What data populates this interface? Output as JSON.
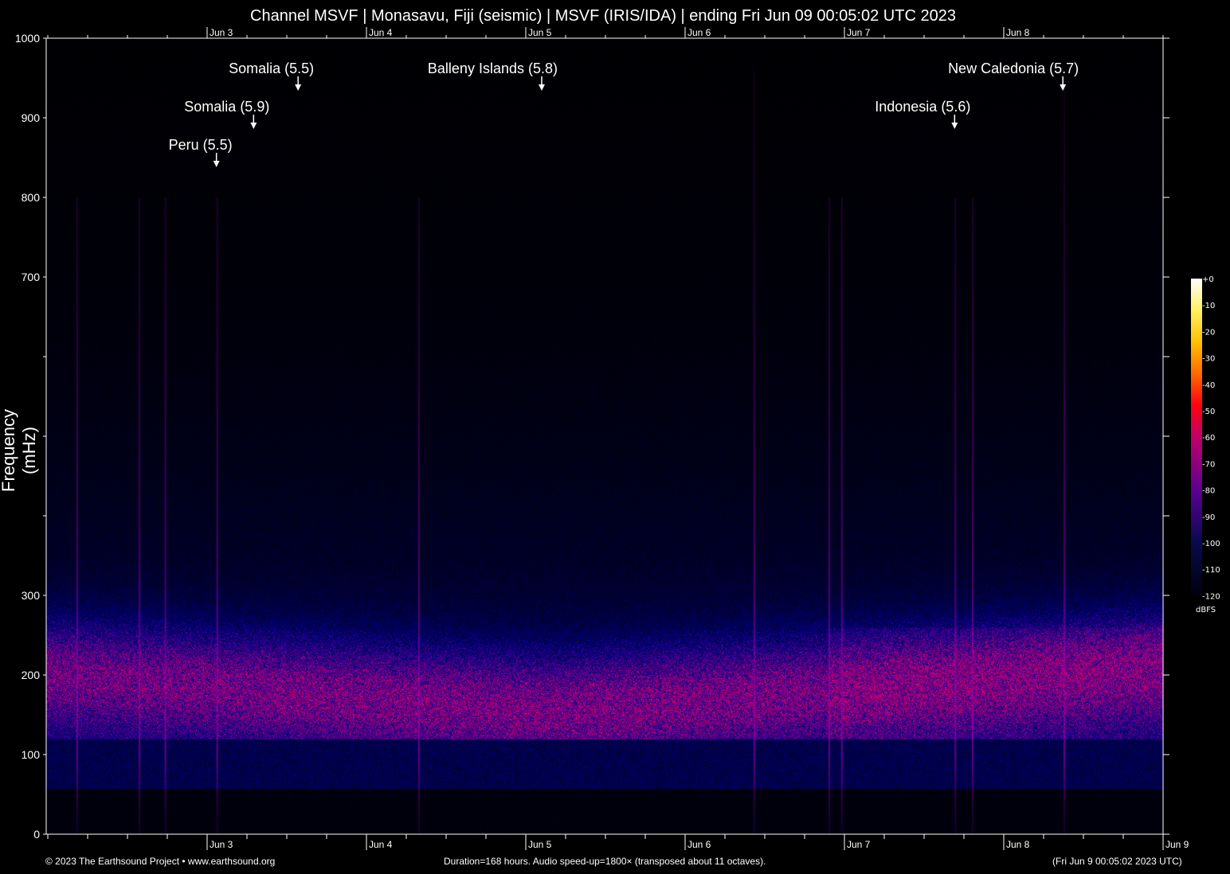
{
  "chart_data": {
    "type": "heatmap",
    "title": "Channel MSVF | Monasavu, Fiji (seismic) | MSVF (IRIS/IDA) | ending Fri Jun 09 00:05:02 UTC 2023",
    "ylabel": "Frequency (mHz)",
    "ylim": [
      0,
      1000
    ],
    "yticks": [
      0,
      100,
      200,
      300,
      400,
      500,
      600,
      700,
      800,
      900,
      1000
    ],
    "ytick_labels": [
      "0",
      "100",
      "200",
      "300",
      "",
      "",
      "",
      "700",
      "800",
      "900",
      "1000"
    ],
    "x_start": "Jun 2 00:05 UTC",
    "x_hours": 168,
    "xticks": [
      {
        "label": "Jun 3",
        "hour": 24
      },
      {
        "label": "Jun 4",
        "hour": 48
      },
      {
        "label": "Jun 5",
        "hour": 72
      },
      {
        "label": "Jun 6",
        "hour": 96
      },
      {
        "label": "Jun 7",
        "hour": 120
      },
      {
        "label": "Jun 8",
        "hour": 144
      },
      {
        "label": "Jun 9",
        "hour": 168
      }
    ],
    "top_xtick_labels": [
      "Jun 3",
      "Jun 4",
      "Jun 5",
      "Jun 6",
      "Jun 7",
      "Jun 8"
    ],
    "colorbar": {
      "label": "dBFS",
      "range": [
        -120,
        0
      ],
      "ticks": [
        "+0",
        "-10",
        "-20",
        "-30",
        "-40",
        "-50",
        "-60",
        "-70",
        "-80",
        "-90",
        "-100",
        "-110",
        "-120"
      ]
    },
    "events": [
      {
        "label": "Peru (5.5)",
        "hour": 25.4
      },
      {
        "label": "Somalia (5.9)",
        "hour": 31.0
      },
      {
        "label": "Somalia (5.5)",
        "hour": 37.7
      },
      {
        "label": "Balleny Islands (5.8)",
        "hour": 74.4
      },
      {
        "label": "Indonesia (5.6)",
        "hour": 136.6
      },
      {
        "label": "New Caledonia (5.7)",
        "hour": 152.9
      }
    ],
    "streak_hours": [
      4.3,
      13.7,
      17.6,
      25.4,
      55.8,
      106.3,
      117.6,
      119.5,
      136.6,
      139.2,
      153.0
    ]
  },
  "footer": {
    "copyright": "© 2023 The Earthsound Project • www.earthsound.org",
    "info": "Duration=168 hours. Audio speed-up=1800× (transposed about 11 octaves).",
    "end_time": "(Fri Jun  9 00:05:02 2023 UTC)"
  }
}
